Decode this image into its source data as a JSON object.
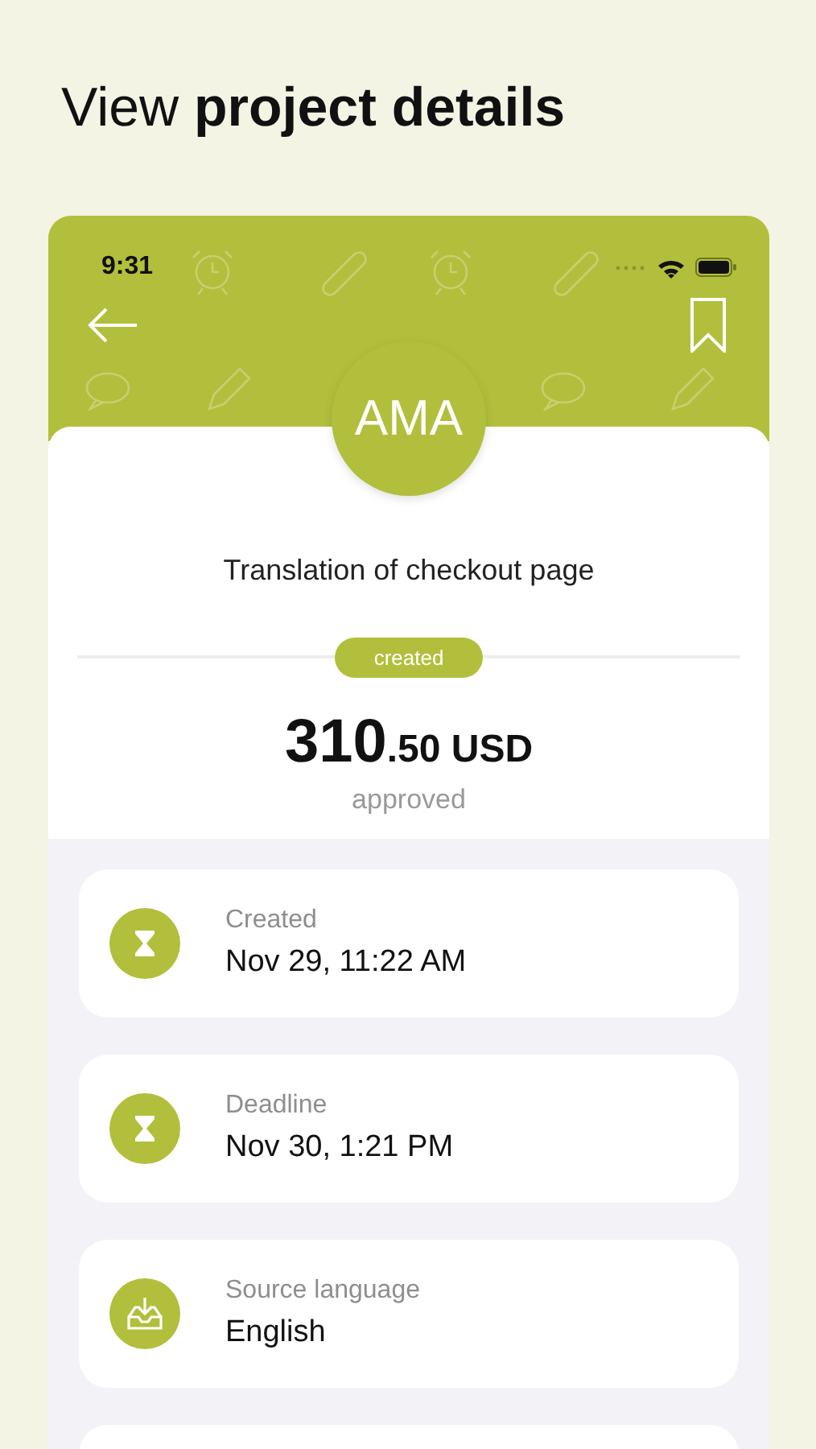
{
  "headline": "View **project details**",
  "status_bar": {
    "time": "9:31"
  },
  "avatar": {
    "initials": "AMA"
  },
  "project": {
    "title": "Translation of checkout page",
    "status": "created",
    "amount_integer": "310",
    "amount_rest": ".50 USD",
    "amount_note": "approved"
  },
  "details": [
    {
      "kind": "date",
      "label": "Created",
      "value": "Nov 29, 11:22 AM"
    },
    {
      "kind": "date",
      "label": "Deadline",
      "value": "Nov 30, 1:21 PM"
    },
    {
      "kind": "language",
      "label": "Source language",
      "value": "English"
    }
  ]
}
